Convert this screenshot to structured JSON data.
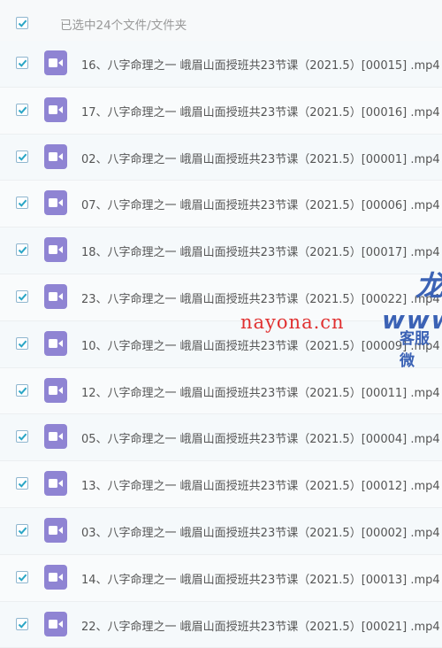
{
  "header": {
    "selection_text": "已选中24个文件/文件夹"
  },
  "files": [
    {
      "name": "16、八字命理之一 峨眉山面授班共23节课（2021.5）[00015] .mp4"
    },
    {
      "name": "17、八字命理之一 峨眉山面授班共23节课（2021.5）[00016] .mp4"
    },
    {
      "name": "02、八字命理之一 峨眉山面授班共23节课（2021.5）[00001] .mp4"
    },
    {
      "name": "07、八字命理之一 峨眉山面授班共23节课（2021.5）[00006] .mp4"
    },
    {
      "name": "18、八字命理之一 峨眉山面授班共23节课（2021.5）[00017] .mp4"
    },
    {
      "name": "23、八字命理之一 峨眉山面授班共23节课（2021.5）[00022] .mp4"
    },
    {
      "name": "10、八字命理之一 峨眉山面授班共23节课（2021.5）[00009] .mp4"
    },
    {
      "name": "12、八字命理之一 峨眉山面授班共23节课（2021.5）[00011] .mp4"
    },
    {
      "name": "05、八字命理之一 峨眉山面授班共23节课（2021.5）[00004] .mp4"
    },
    {
      "name": "13、八字命理之一 峨眉山面授班共23节课（2021.5）[00012] .mp4"
    },
    {
      "name": "03、八字命理之一 峨眉山面授班共23节课（2021.5）[00002] .mp4"
    },
    {
      "name": "14、八字命理之一 峨眉山面授班共23节课（2021.5）[00013] .mp4"
    },
    {
      "name": "22、八字命理之一 峨眉山面授班共23节课（2021.5）[00021] .mp4"
    }
  ],
  "watermarks": {
    "site": "nayona.cn",
    "brand_char": "龙",
    "www": "www",
    "service": "客服微"
  },
  "colors": {
    "checkbox_check": "#2aa6c6",
    "video_icon_bg": "#8f84d3",
    "watermark_red": "#e03030",
    "watermark_blue": "#3b62b5"
  }
}
